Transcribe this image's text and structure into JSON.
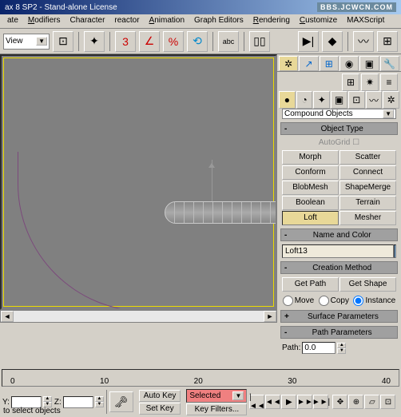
{
  "titlebar": {
    "text": "ax 8 SP2 - Stand-alone License",
    "watermark": "BBS.JCWCN.COM"
  },
  "menu": {
    "m1": "ate",
    "m2": "Modifiers",
    "m3": "Character",
    "m4": "reactor",
    "m5": "Animation",
    "m6": "Graph Editors",
    "m7": "Rendering",
    "m8": "Customize",
    "m9": "MAXScript"
  },
  "toolbar": {
    "viewmode": "View"
  },
  "panel": {
    "category": "Compound Objects",
    "roll_objtype": "Object Type",
    "autogrid": "AutoGrid",
    "btns": {
      "morph": "Morph",
      "scatter": "Scatter",
      "conform": "Conform",
      "connect": "Connect",
      "blobmesh": "BlobMesh",
      "shapemerge": "ShapeMerge",
      "boolean": "Boolean",
      "terrain": "Terrain",
      "loft": "Loft",
      "mesher": "Mesher"
    },
    "roll_name": "Name and Color",
    "objname": "Loft13",
    "roll_create": "Creation Method",
    "getpath": "Get Path",
    "getshape": "Get Shape",
    "r_move": "Move",
    "r_copy": "Copy",
    "r_inst": "Instance",
    "roll_surf": "Surface Parameters",
    "roll_path": "Path Parameters",
    "path_lbl": "Path:",
    "path_val": "0.0"
  },
  "timeline": {
    "t0": "0",
    "t1": "10",
    "t2": "20",
    "t3": "30",
    "t4": "40"
  },
  "status": {
    "y": "Y:",
    "z": "Z:",
    "autokey": "Auto Key",
    "setkey": "Set Key",
    "selected": "Selected",
    "keyfilters": "Key Filters...",
    "selectmsg": "to select objects"
  }
}
